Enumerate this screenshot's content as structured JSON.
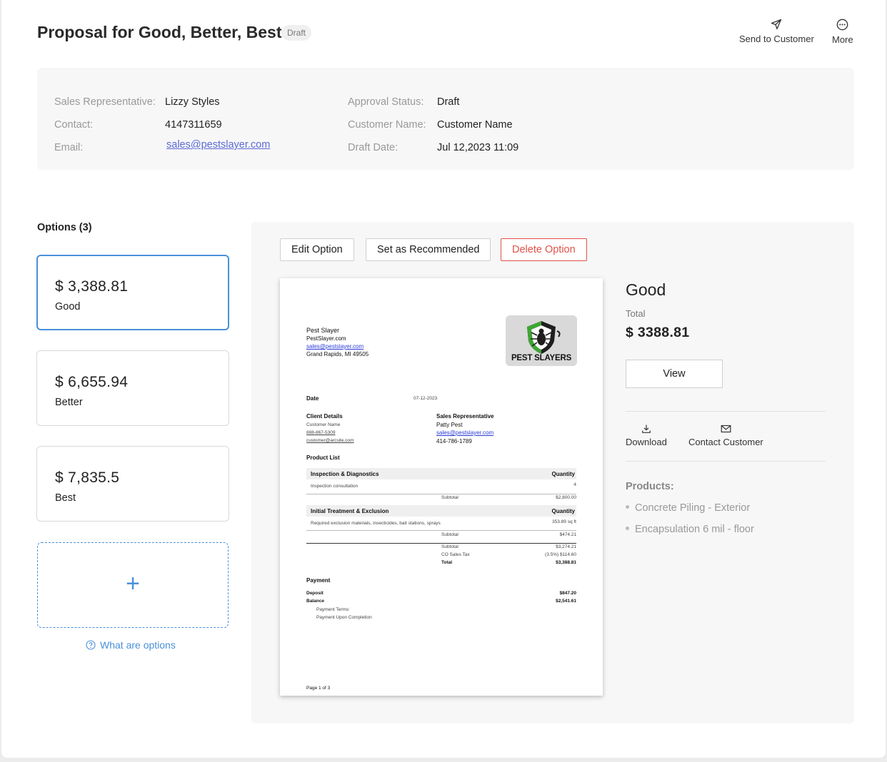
{
  "header": {
    "title": "Proposal for Good, Better, Best",
    "status_badge": "Draft",
    "actions": {
      "send_label": "Send to Customer",
      "send_icon": "send-icon",
      "more_label": "More",
      "more_icon": "more-icon"
    }
  },
  "info": {
    "sales_rep_label": "Sales Representative:",
    "sales_rep_value": "Lizzy Styles",
    "contact_label": "Contact:",
    "contact_value": "4147311659",
    "email_label": "Email:",
    "email_value": "sales@pestslayer.com",
    "approval_label": "Approval Status:",
    "approval_value": "Draft",
    "customer_label": "Customer Name:",
    "customer_value": "Customer Name",
    "draft_date_label": "Draft Date:",
    "draft_date_value": "Jul 12,2023 11:09"
  },
  "options": {
    "heading": "Options (3)",
    "items": [
      {
        "price": "$ 3,388.81",
        "name": "Good",
        "selected": true
      },
      {
        "price": "$ 6,655.94",
        "name": "Better",
        "selected": false
      },
      {
        "price": "$ 7,835.5",
        "name": "Best",
        "selected": false
      }
    ],
    "add_label": "+",
    "help_label": "What are options"
  },
  "toolbar": {
    "edit_label": "Edit Option",
    "recommend_label": "Set as Recommended",
    "delete_label": "Delete Option"
  },
  "document": {
    "company": "Pest Slayer",
    "website": "PestSlayer.com",
    "email": "sales@pestslayer.com",
    "address": "Grand Rapids, MI 49505",
    "logo_text": "PEST SLAYERS",
    "date_label": "Date",
    "date_value": "07-12-2023",
    "client_heading": "Client Details",
    "client_name": "Customer Name",
    "client_phone": "888-867-5309",
    "client_email": "customer@arcsite.com",
    "rep_heading": "Sales Representative",
    "rep_name": "Patty Pest",
    "rep_email": "sales@pestslayer.com",
    "rep_phone": "414-786-1789",
    "product_list_heading": "Product List",
    "section1_title": "Inspection & Diagnostics",
    "section1_qty_header": "Quantity",
    "section1_item": "Inspection consultation",
    "section1_item_qty": "4",
    "section1_subtotal_label": "Subtotal",
    "section1_subtotal": "$2,800.00",
    "section2_title": "Initial Treatment & Exclusion",
    "section2_qty_header": "Quantity",
    "section2_item": "Required exclusion materials, insecticides, bait stations, sprays",
    "section2_item_qty": "353.89 sq ft",
    "section2_subtotal_label": "Subtotal",
    "section2_subtotal": "$474.21",
    "summary_subtotal_label": "Subtotal",
    "summary_subtotal": "$3,274.21",
    "tax_label": "CO Sales Tax",
    "tax_value": "(3.5%) $114.60",
    "total_label": "Total",
    "total_value": "$3,388.81",
    "payment_heading": "Payment",
    "deposit_label": "Deposit",
    "deposit_value": "$847.20",
    "balance_label": "Balance",
    "balance_value": "$2,541.61",
    "terms_label": "Payment Terms:",
    "terms_value": "Payment Upon Completion",
    "page_label": "Page 1 of 3"
  },
  "detail": {
    "title": "Good",
    "total_label": "Total",
    "total_value": "$ 3388.81",
    "view_label": "View",
    "download_label": "Download",
    "download_icon": "download-icon",
    "contact_label": "Contact Customer",
    "contact_icon": "mail-icon",
    "products_label": "Products:",
    "products": [
      "Concrete Piling - Exterior",
      "Encapsulation 6 mil - floor"
    ]
  },
  "colors": {
    "accent": "#4a90d9",
    "danger": "#e0534a",
    "link": "#5b6bd6",
    "panel": "#f7f7f7"
  }
}
